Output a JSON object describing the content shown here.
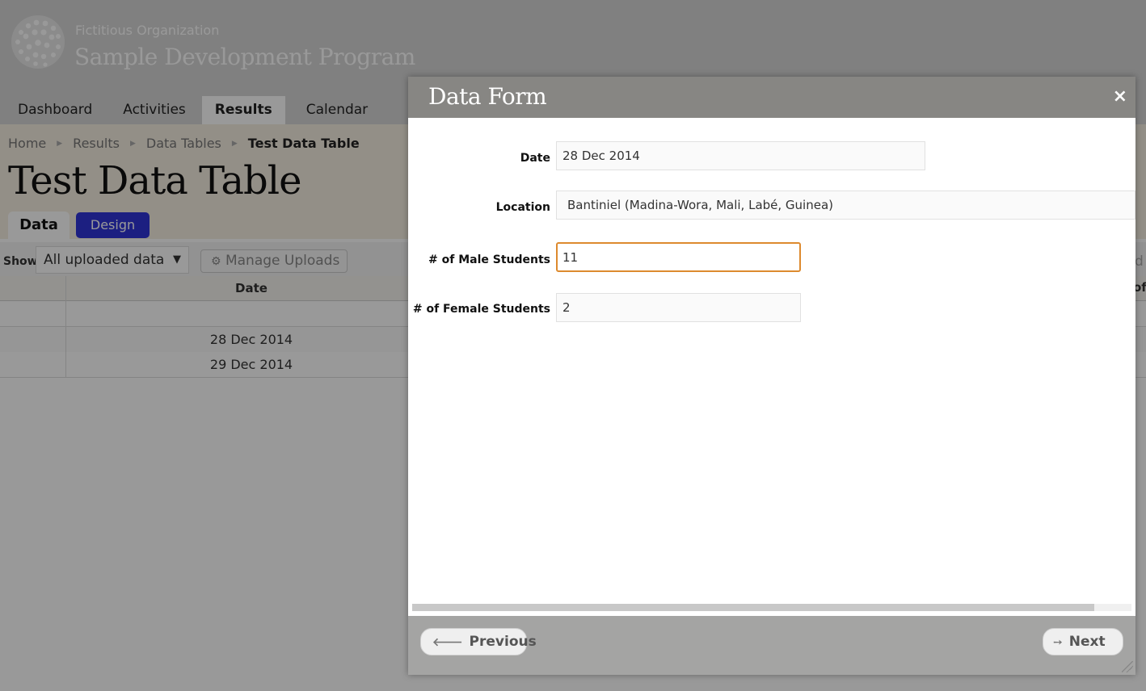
{
  "header": {
    "org_name": "Fictitious Organization",
    "program_name": "Sample Development Program",
    "nav": [
      {
        "label": "Dashboard"
      },
      {
        "label": "Activities"
      },
      {
        "label": "Results",
        "active": true
      },
      {
        "label": "Calendar"
      }
    ]
  },
  "breadcrumb": [
    "Home",
    "Results",
    "Data Tables",
    "Test Data Table"
  ],
  "page_title": "Test Data Table",
  "tabs": {
    "data": "Data",
    "design": "Design"
  },
  "toolbar": {
    "show_label": "Show",
    "show_value": "All uploaded data",
    "manage_uploads": "Manage Uploads",
    "right_edge_text": "d"
  },
  "table": {
    "headers": {
      "date": "Date",
      "right_edge": "of"
    },
    "rows": [
      {
        "date": ""
      },
      {
        "date": "28 Dec 2014"
      },
      {
        "date": "29 Dec 2014"
      }
    ]
  },
  "dialog": {
    "title": "Data Form",
    "close_icon": "×",
    "fields": {
      "date": {
        "label": "Date",
        "value": "28 Dec 2014"
      },
      "location": {
        "label": "Location",
        "value": "Bantiniel (Madina-Wora, Mali, Labé, Guinea)"
      },
      "male_students": {
        "label": "# of Male Students",
        "value": "11"
      },
      "female_students": {
        "label": "# of Female Students",
        "value": "2"
      }
    },
    "previous_label": "Previous",
    "next_label": "Next",
    "previous_icon": "arrow-left-icon",
    "next_icon": "arrow-right-icon"
  },
  "colors": {
    "accent": "#dd8a2e",
    "design_tab": "#3035d8",
    "dialog_titlebar": "#878683",
    "dialog_footer": "#a4a4a3"
  }
}
